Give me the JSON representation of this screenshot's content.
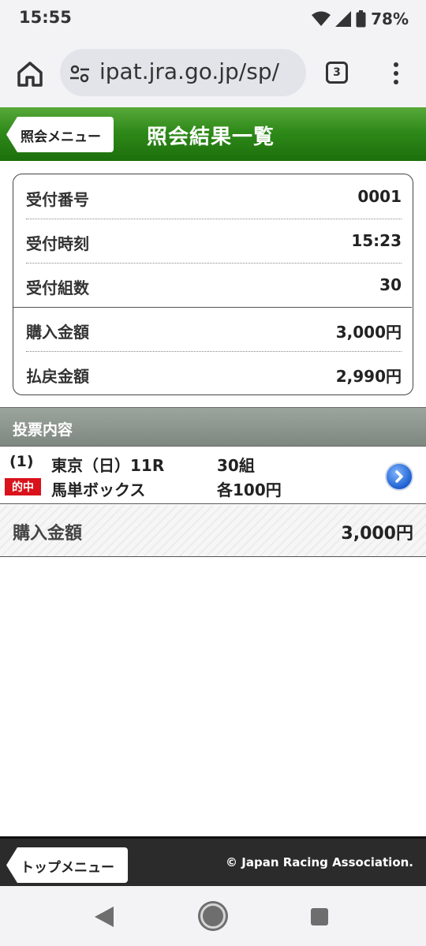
{
  "status_bar": {
    "time": "15:55",
    "battery": "78%"
  },
  "browser": {
    "url": "ipat.jra.go.jp/sp/",
    "tab_count": "3"
  },
  "header": {
    "back_label": "照会メニュー",
    "title": "照会結果一覧"
  },
  "summary": {
    "rows": [
      {
        "label": "受付番号",
        "value": "0001"
      },
      {
        "label": "受付時刻",
        "value": "15:23"
      },
      {
        "label": "受付組数",
        "value": "30"
      },
      {
        "label": "購入金額",
        "value": "3,000円"
      },
      {
        "label": "払戻金額",
        "value": "2,990円"
      }
    ]
  },
  "votes": {
    "section_label": "投票内容",
    "items": [
      {
        "index": "(1)",
        "race": "東京（日）11R",
        "combos": "30組",
        "result_badge": "的中",
        "bet_type": "馬単ボックス",
        "amount_each": "各100円"
      }
    ],
    "total_label": "購入金額",
    "total_value": "3,000円"
  },
  "footer": {
    "top_menu_label": "トップメニュー",
    "copyright": "© Japan Racing Association."
  },
  "colors": {
    "header_green": "#2f8a19",
    "hit_badge_red": "#d9121b",
    "footer_dark": "#2b2b2b"
  }
}
